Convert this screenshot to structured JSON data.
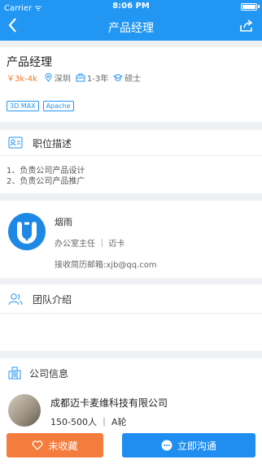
{
  "statusbar": {
    "carrier": "Carrier ᯤ",
    "time": "8:06 PM"
  },
  "navbar": {
    "back_icon": "chevron-left-icon",
    "title": "产品经理",
    "share_icon": "share-icon"
  },
  "job": {
    "title": "产品经理",
    "salary": "￥3k-4k",
    "location": "深圳",
    "experience": "1-3年",
    "education": "硕士",
    "tags": [
      "3D MAX",
      "Apache"
    ]
  },
  "description": {
    "heading": "职位描述",
    "lines": [
      "1、负责公司产品设计",
      "2、负责公司产品推广"
    ]
  },
  "recruiter": {
    "name": "烟雨",
    "role": "办公室主任 ｜ 迈卡",
    "email": "接收简历邮箱:xjb@qq.com"
  },
  "team": {
    "heading": "团队介绍"
  },
  "company": {
    "heading": "公司信息",
    "name": "成都迈卡麦维科技有限公司",
    "meta": "150-500人 ｜ A轮"
  },
  "actions": {
    "favorite": "未收藏",
    "chat": "立即沟通"
  },
  "colors": {
    "primary": "#2196f3",
    "accent": "#f47c3c"
  }
}
